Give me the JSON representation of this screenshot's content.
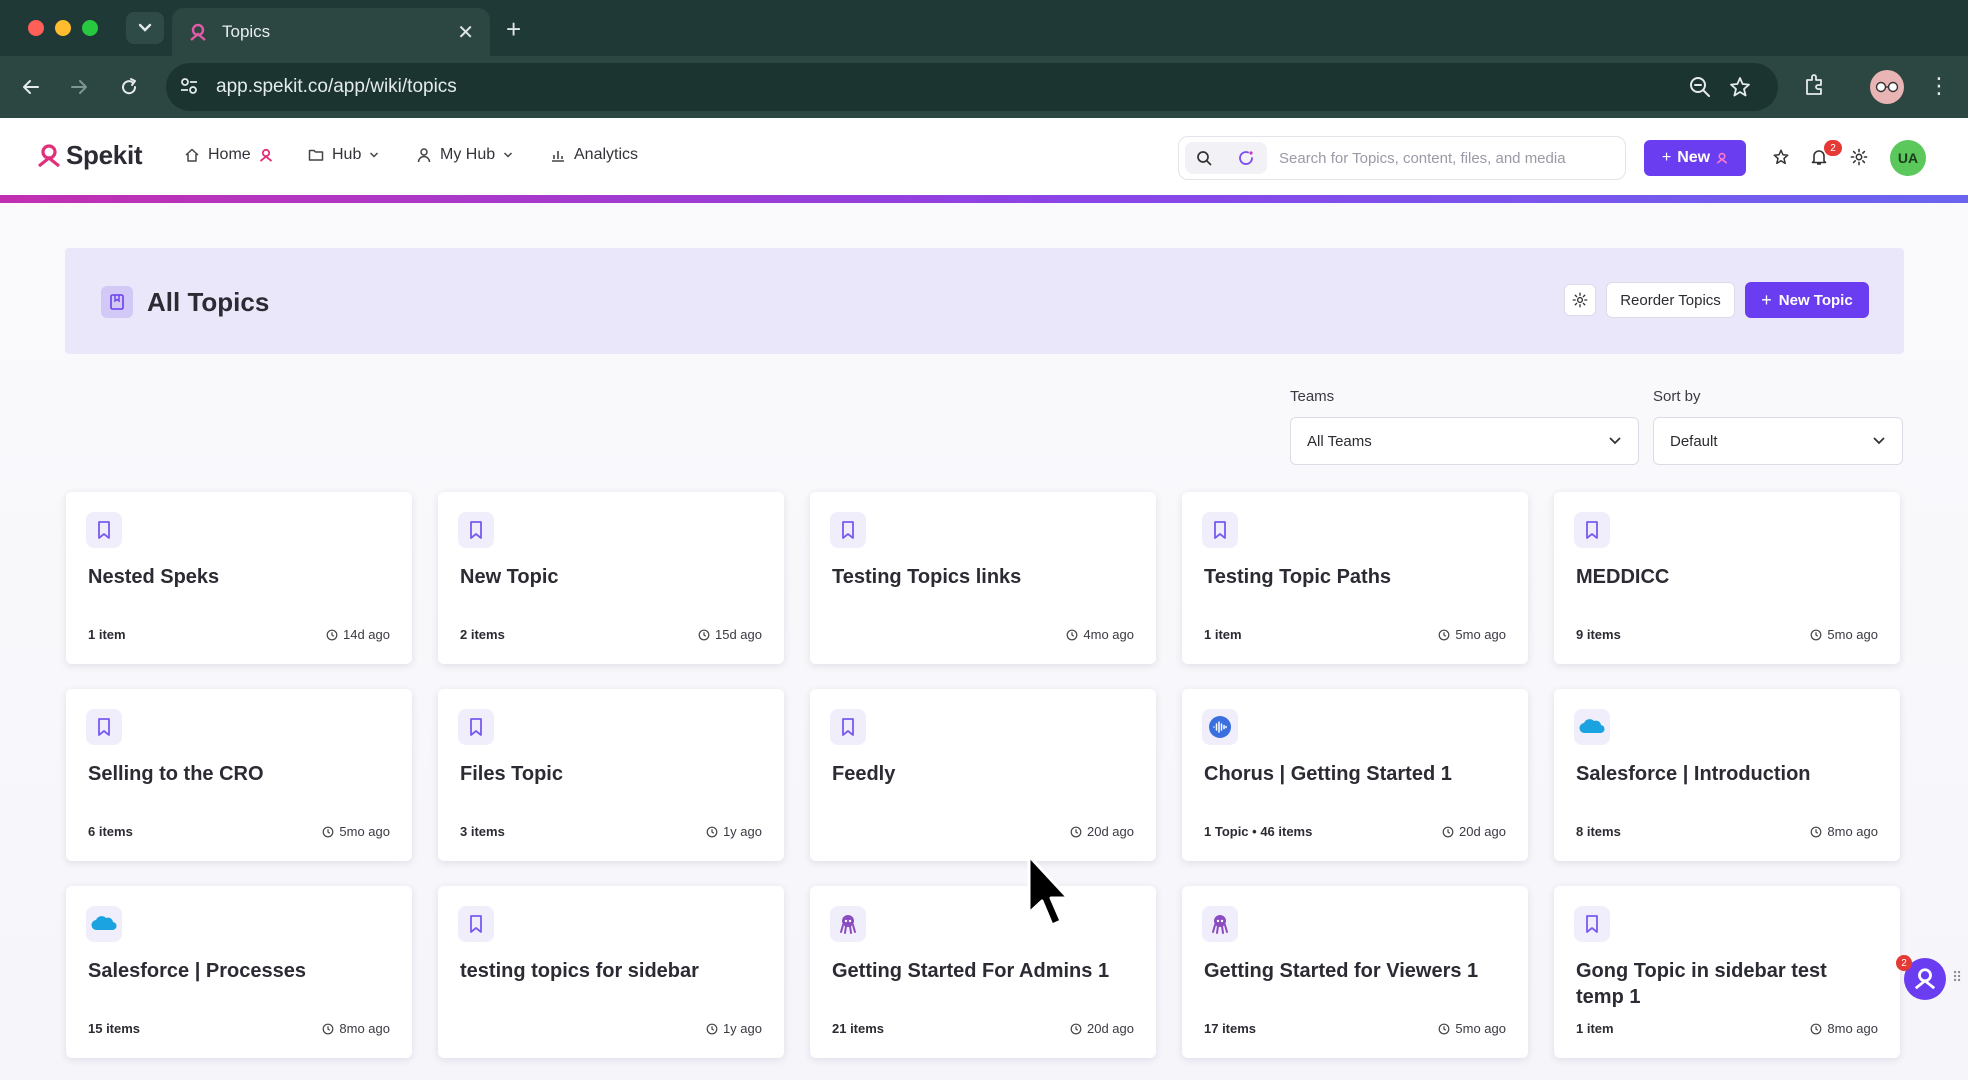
{
  "browser": {
    "tab_title": "Topics",
    "url": "app.spekit.co/app/wiki/topics"
  },
  "header": {
    "brand": "Spekit",
    "nav": [
      {
        "label": "Home"
      },
      {
        "label": "Hub"
      },
      {
        "label": "My Hub"
      },
      {
        "label": "Analytics"
      }
    ],
    "search_placeholder": "Search for Topics, content, files, and media",
    "new_label": "New",
    "notification_count": "2",
    "avatar_initials": "UA"
  },
  "page": {
    "title": "All Topics",
    "reorder_label": "Reorder Topics",
    "new_topic_label": "New Topic",
    "teams_label": "Teams",
    "teams_value": "All Teams",
    "sort_label": "Sort by",
    "sort_value": "Default"
  },
  "topics": [
    {
      "title": "Nested Speks",
      "count": "1 item",
      "time": "14d ago",
      "icon": "bookmark-icon"
    },
    {
      "title": "New Topic",
      "count": "2 items",
      "time": "15d ago",
      "icon": "bookmark-icon"
    },
    {
      "title": "Testing Topics links",
      "count": "",
      "time": "4mo ago",
      "icon": "bookmark-icon"
    },
    {
      "title": "Testing Topic Paths",
      "count": "1 item",
      "time": "5mo ago",
      "icon": "bookmark-icon"
    },
    {
      "title": "MEDDICC",
      "count": "9 items",
      "time": "5mo ago",
      "icon": "bookmark-icon"
    },
    {
      "title": "Selling to the CRO",
      "count": "6 items",
      "time": "5mo ago",
      "icon": "bookmark-icon"
    },
    {
      "title": "Files Topic",
      "count": "3 items",
      "time": "1y ago",
      "icon": "bookmark-icon"
    },
    {
      "title": "Feedly",
      "count": "",
      "time": "20d ago",
      "icon": "bookmark-icon"
    },
    {
      "title": "Chorus | Getting Started 1",
      "count": "1 Topic  •  46 items",
      "time": "20d ago",
      "icon": "chorus-icon"
    },
    {
      "title": "Salesforce | Introduction",
      "count": "8 items",
      "time": "8mo ago",
      "icon": "salesforce-icon"
    },
    {
      "title": "Salesforce | Processes",
      "count": "15 items",
      "time": "8mo ago",
      "icon": "salesforce-icon"
    },
    {
      "title": "testing topics for sidebar",
      "count": "",
      "time": "1y ago",
      "icon": "bookmark-icon"
    },
    {
      "title": "Getting Started For Admins 1",
      "count": "21 items",
      "time": "20d ago",
      "icon": "octopus-icon"
    },
    {
      "title": "Getting Started for Viewers 1",
      "count": "17 items",
      "time": "5mo ago",
      "icon": "octopus-icon"
    },
    {
      "title": "Gong Topic in sidebar test temp 1",
      "count": "1 item",
      "time": "8mo ago",
      "icon": "bookmark-icon"
    }
  ],
  "assistant_badge": "2",
  "colors": {
    "accent": "#6a3ef0",
    "banner": "#ebe7fb",
    "chrome_dark": "#1f3a36"
  }
}
